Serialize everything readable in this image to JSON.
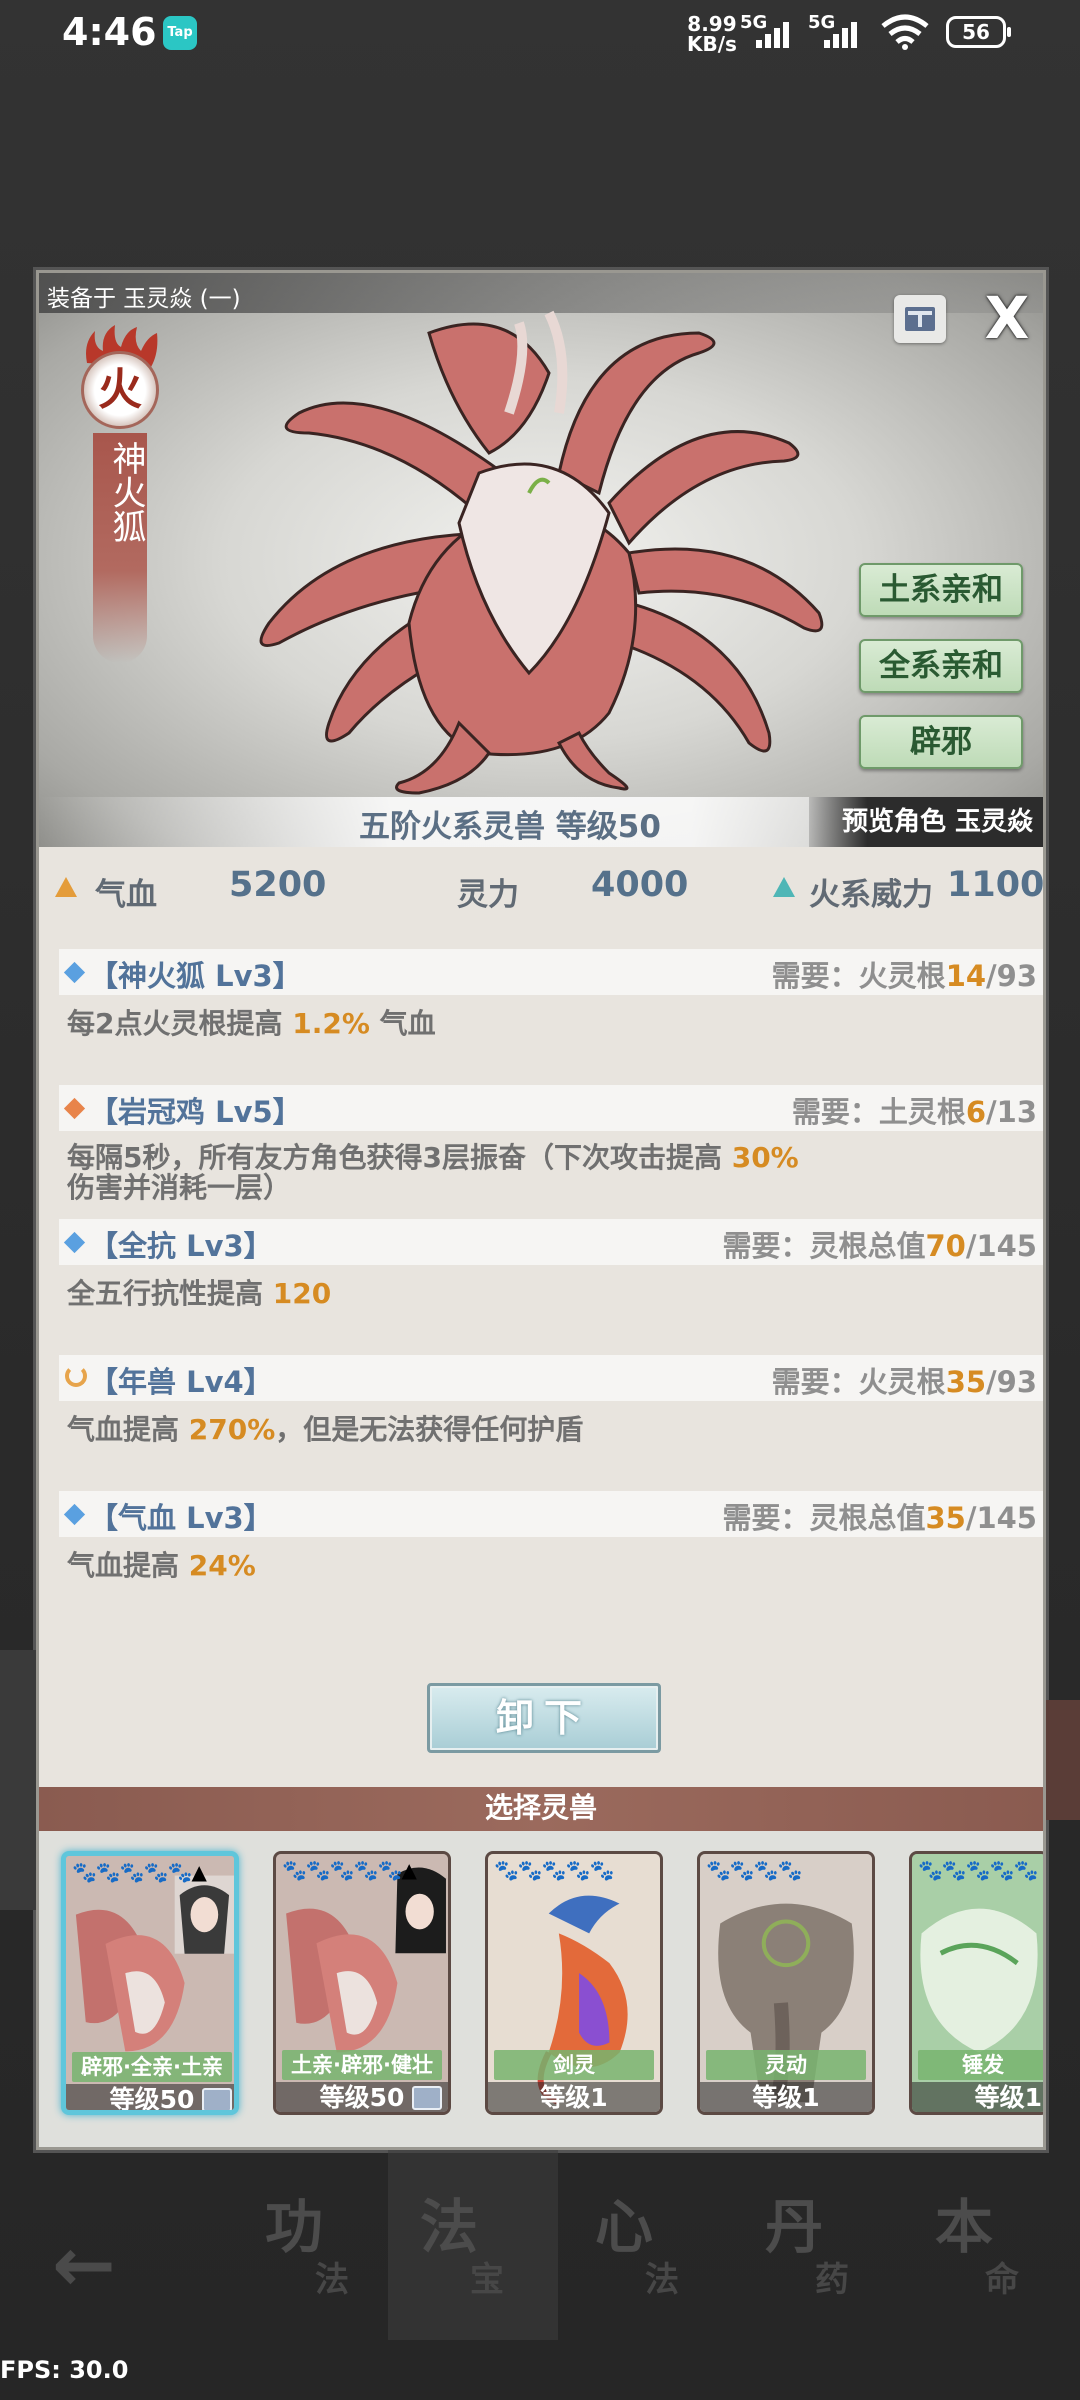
{
  "status_bar": {
    "time": "4:46",
    "tap_badge": "Tap",
    "speed_value": "8.99",
    "speed_unit": "KB/s",
    "sim1": "5G",
    "sim2": "5G",
    "battery": "56"
  },
  "panel": {
    "equipped_label": "装备于 玉灵焱 (一)",
    "close_label": "X",
    "element_char": "火",
    "beast_name": "神火狐",
    "affinity_buttons": [
      "土系亲和",
      "全系亲和",
      "辟邪"
    ],
    "tier_level": "五阶火系灵兽     等级50",
    "preview_role": "预览角色 玉灵焱"
  },
  "stats": {
    "hp_label": "气血",
    "hp_value": "5200",
    "spirit_label": "灵力",
    "spirit_value": "4000",
    "fire_label": "火系威力",
    "fire_value": "1100"
  },
  "skills": [
    {
      "name": "【神火狐 Lv3】",
      "req_label": "需要：",
      "req_type": "火灵根",
      "req_cur": "14",
      "req_max": "/93",
      "desc_pre": "每2点火灵根提高 ",
      "desc_hl": "1.2%",
      "desc_post": " 气血",
      "diamond_color": "#5aa0e0"
    },
    {
      "name": "【岩冠鸡 Lv5】",
      "req_label": "需要：",
      "req_type": "土灵根",
      "req_cur": "6",
      "req_max": "/13",
      "desc_pre": "每隔5秒，所有友方角色获得3层振奋（下次攻击提高 ",
      "desc_hl": "30%",
      "desc_post": " 伤害并消耗一层）",
      "diamond_color": "#e8844a"
    },
    {
      "name": "【全抗 Lv3】",
      "req_label": "需要：",
      "req_type": "灵根总值",
      "req_cur": "70",
      "req_max": "/145",
      "desc_pre": "全五行抗性提高 ",
      "desc_hl": "120",
      "desc_post": "",
      "diamond_color": "#5aa0e0"
    },
    {
      "name": "【年兽 Lv4】",
      "req_label": "需要：",
      "req_type": "火灵根",
      "req_cur": "35",
      "req_max": "/93",
      "desc_pre": "气血提高 ",
      "desc_hl": "270%",
      "desc_post": "，但是无法获得任何护盾",
      "diamond_color": "#e7a44b"
    },
    {
      "name": "【气血 Lv3】",
      "req_label": "需要：",
      "req_type": "灵根总值",
      "req_cur": "35",
      "req_max": "/145",
      "desc_pre": "气血提高 ",
      "desc_hl": "24%",
      "desc_post": "",
      "diamond_color": "#5aa0e0"
    }
  ],
  "unequip_label": "卸下",
  "select_title": "选择灵兽",
  "cards": [
    {
      "tag": "辟邪·全亲·土亲",
      "level": "等级50",
      "stars": "🐾🐾🐾🐾🐾▲",
      "selected": true
    },
    {
      "tag": "土亲·辟邪·健壮",
      "level": "等级50",
      "stars": "🐾🐾🐾🐾🐾▲",
      "selected": false
    },
    {
      "tag": "剑灵",
      "level": "等级1",
      "stars": "🐾🐾🐾🐾🐾",
      "selected": false
    },
    {
      "tag": "灵动",
      "level": "等级1",
      "stars": "🐾🐾🐾🐾",
      "selected": false
    },
    {
      "tag": "锤发",
      "level": "等级1",
      "stars": "🐾🐾🐾🐾🐾",
      "selected": false
    }
  ],
  "bottom_nav": {
    "back": "←",
    "items": [
      {
        "big": "功",
        "small": "法"
      },
      {
        "big": "法",
        "small": "宝"
      },
      {
        "big": "心",
        "small": "法"
      },
      {
        "big": "丹",
        "small": "药"
      },
      {
        "big": "本",
        "small": "命"
      }
    ]
  },
  "fps_label": "FPS: 30.0"
}
